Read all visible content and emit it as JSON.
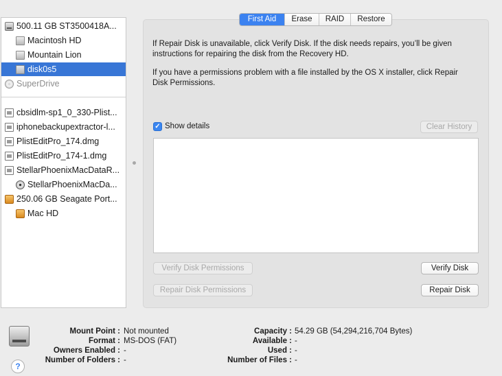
{
  "sidebar": {
    "items": [
      {
        "label": "500.11 GB ST3500418A...",
        "icon": "internal-disk-icon"
      },
      {
        "label": "Macintosh HD",
        "icon": "volume-icon"
      },
      {
        "label": "Mountain Lion",
        "icon": "volume-icon"
      },
      {
        "label": "disk0s5",
        "icon": "volume-icon",
        "selected": true
      },
      {
        "label": "SuperDrive",
        "icon": "optical-drive-icon"
      },
      {
        "label": "cbsidlm-sp1_0_330-Plist...",
        "icon": "disk-image-icon"
      },
      {
        "label": "iphonebackupextractor-l...",
        "icon": "disk-image-icon"
      },
      {
        "label": "PlistEditPro_174.dmg",
        "icon": "disk-image-icon"
      },
      {
        "label": "PlistEditPro_174-1.dmg",
        "icon": "disk-image-icon"
      },
      {
        "label": "StellarPhoenixMacDataR...",
        "icon": "disk-image-icon"
      },
      {
        "label": "StellarPhoenixMacDa...",
        "icon": "mounted-image-icon"
      },
      {
        "label": "250.06 GB Seagate Port...",
        "icon": "external-disk-icon"
      },
      {
        "label": "Mac HD",
        "icon": "external-volume-icon"
      }
    ]
  },
  "tabs": [
    {
      "label": "First Aid",
      "active": true
    },
    {
      "label": "Erase"
    },
    {
      "label": "RAID"
    },
    {
      "label": "Restore"
    }
  ],
  "first_aid": {
    "paragraph1": "If Repair Disk is unavailable, click Verify Disk. If the disk needs repairs, you’ll be given instructions for repairing the disk from the Recovery HD.",
    "paragraph2": "If you have a permissions problem with a file installed by the OS X installer, click Repair Disk Permissions.",
    "show_details_label": "Show details",
    "show_details_checked": true,
    "clear_history": "Clear History",
    "verify_permissions": "Verify Disk Permissions",
    "repair_permissions": "Repair Disk Permissions",
    "verify_disk": "Verify Disk",
    "repair_disk": "Repair Disk"
  },
  "info": {
    "mount_point_label": "Mount Point :",
    "mount_point_value": "Not mounted",
    "format_label": "Format :",
    "format_value": "MS-DOS (FAT)",
    "owners_label": "Owners Enabled :",
    "owners_value": "-",
    "folders_label": "Number of Folders :",
    "folders_value": "-",
    "capacity_label": "Capacity :",
    "capacity_value": "54.29 GB (54,294,216,704 Bytes)",
    "available_label": "Available :",
    "available_value": "-",
    "used_label": "Used :",
    "used_value": "-",
    "files_label": "Number of Files :",
    "files_value": "-"
  },
  "help_glyph": "?",
  "check_glyph": "✓",
  "colors": {
    "selection": "#3876d6",
    "accent": "#3b82f0"
  }
}
